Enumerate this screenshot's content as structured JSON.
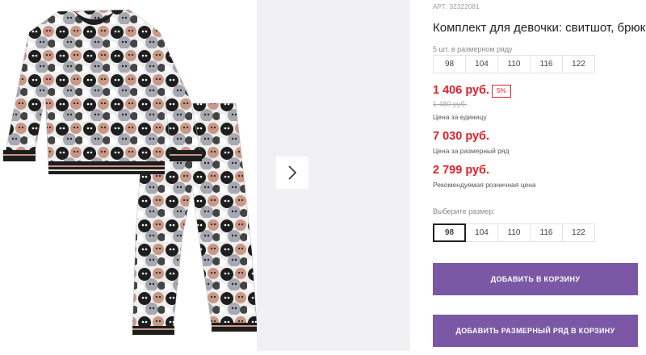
{
  "product": {
    "sku": "АРТ: 32322081",
    "title": "Комплект для девочки: свитшот, брюки"
  },
  "gallery": {
    "image_alt": "product-photo",
    "next_icon": "chevron-right-icon"
  },
  "size_range": {
    "label": "5 шт. в размерном ряду",
    "sizes": [
      "98",
      "104",
      "110",
      "116",
      "122"
    ]
  },
  "pricing": {
    "unit_price": "1 406 руб.",
    "discount": "5%",
    "old_price": "1 480 руб.",
    "unit_caption": "Цена за единицу",
    "range_price": "7 030 руб.",
    "range_caption": "Цена за размерный ряд",
    "retail_price": "2 799 руб.",
    "retail_caption": "Рекомендуемая розничная цена"
  },
  "size_select": {
    "label": "Выберите размер:",
    "sizes": [
      "98",
      "104",
      "110",
      "116",
      "122"
    ],
    "selected": "98"
  },
  "actions": {
    "add_to_cart": "ДОБАВИТЬ В КОРЗИНУ",
    "add_range_to_cart": "ДОБАВИТЬ РАЗМЕРНЫЙ РЯД В КОРЗИНУ"
  },
  "colors": {
    "accent_purple": "#7b58a5",
    "price_red": "#e02128"
  }
}
